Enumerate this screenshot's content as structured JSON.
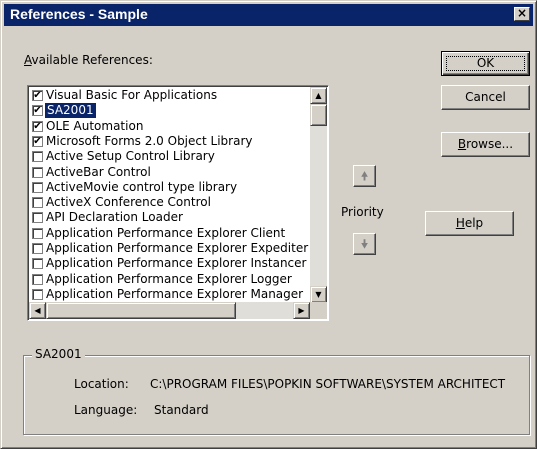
{
  "window": {
    "title": "References - Sample",
    "close_glyph": "×"
  },
  "available_label_accel": "A",
  "available_label_rest": "vailable References:",
  "references": [
    {
      "label": "Visual Basic For Applications",
      "checked": true,
      "selected": false
    },
    {
      "label": "SA2001",
      "checked": true,
      "selected": true
    },
    {
      "label": "OLE Automation",
      "checked": true,
      "selected": false
    },
    {
      "label": "Microsoft Forms 2.0 Object Library",
      "checked": true,
      "selected": false
    },
    {
      "label": "Active Setup Control Library",
      "checked": false,
      "selected": false
    },
    {
      "label": "ActiveBar Control",
      "checked": false,
      "selected": false
    },
    {
      "label": "ActiveMovie control type library",
      "checked": false,
      "selected": false
    },
    {
      "label": "ActiveX Conference Control",
      "checked": false,
      "selected": false
    },
    {
      "label": "API Declaration Loader",
      "checked": false,
      "selected": false
    },
    {
      "label": "Application Performance Explorer Client",
      "checked": false,
      "selected": false
    },
    {
      "label": "Application Performance Explorer Expediter",
      "checked": false,
      "selected": false
    },
    {
      "label": "Application Performance Explorer Instancer",
      "checked": false,
      "selected": false
    },
    {
      "label": "Application Performance Explorer Logger",
      "checked": false,
      "selected": false
    },
    {
      "label": "Application Performance Explorer Manager",
      "checked": false,
      "selected": false
    }
  ],
  "buttons": {
    "ok": "OK",
    "cancel": "Cancel",
    "browse_accel": "B",
    "browse_rest": "rowse...",
    "help_accel": "H",
    "help_rest": "elp"
  },
  "priority_label": "Priority",
  "details": {
    "group_title": "SA2001",
    "location_label": "Location:",
    "location_value": "C:\\PROGRAM FILES\\POPKIN SOFTWARE\\SYSTEM ARCHITECT",
    "language_label": "Language:",
    "language_value": "Standard"
  },
  "colors": {
    "titlebar": "#0a246a",
    "face": "#d4d0c8",
    "selection": "#0a246a"
  }
}
